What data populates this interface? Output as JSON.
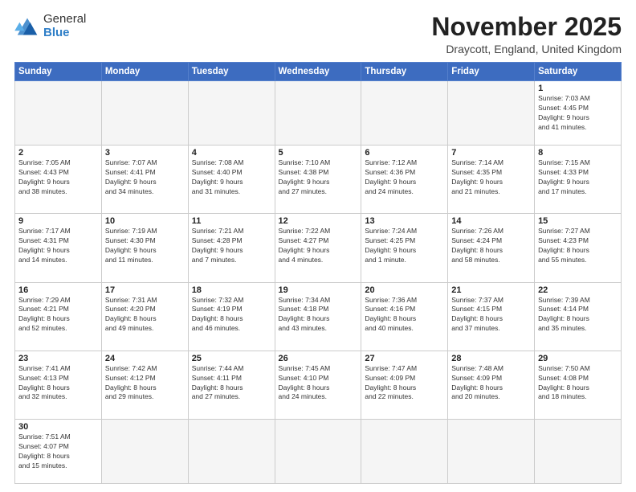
{
  "header": {
    "logo_line1": "General",
    "logo_line2": "Blue",
    "title": "November 2025",
    "subtitle": "Draycott, England, United Kingdom"
  },
  "weekdays": [
    "Sunday",
    "Monday",
    "Tuesday",
    "Wednesday",
    "Thursday",
    "Friday",
    "Saturday"
  ],
  "rows": [
    [
      {
        "day": "",
        "info": ""
      },
      {
        "day": "",
        "info": ""
      },
      {
        "day": "",
        "info": ""
      },
      {
        "day": "",
        "info": ""
      },
      {
        "day": "",
        "info": ""
      },
      {
        "day": "",
        "info": ""
      },
      {
        "day": "1",
        "info": "Sunrise: 7:03 AM\nSunset: 4:45 PM\nDaylight: 9 hours\nand 41 minutes."
      }
    ],
    [
      {
        "day": "2",
        "info": "Sunrise: 7:05 AM\nSunset: 4:43 PM\nDaylight: 9 hours\nand 38 minutes."
      },
      {
        "day": "3",
        "info": "Sunrise: 7:07 AM\nSunset: 4:41 PM\nDaylight: 9 hours\nand 34 minutes."
      },
      {
        "day": "4",
        "info": "Sunrise: 7:08 AM\nSunset: 4:40 PM\nDaylight: 9 hours\nand 31 minutes."
      },
      {
        "day": "5",
        "info": "Sunrise: 7:10 AM\nSunset: 4:38 PM\nDaylight: 9 hours\nand 27 minutes."
      },
      {
        "day": "6",
        "info": "Sunrise: 7:12 AM\nSunset: 4:36 PM\nDaylight: 9 hours\nand 24 minutes."
      },
      {
        "day": "7",
        "info": "Sunrise: 7:14 AM\nSunset: 4:35 PM\nDaylight: 9 hours\nand 21 minutes."
      },
      {
        "day": "8",
        "info": "Sunrise: 7:15 AM\nSunset: 4:33 PM\nDaylight: 9 hours\nand 17 minutes."
      }
    ],
    [
      {
        "day": "9",
        "info": "Sunrise: 7:17 AM\nSunset: 4:31 PM\nDaylight: 9 hours\nand 14 minutes."
      },
      {
        "day": "10",
        "info": "Sunrise: 7:19 AM\nSunset: 4:30 PM\nDaylight: 9 hours\nand 11 minutes."
      },
      {
        "day": "11",
        "info": "Sunrise: 7:21 AM\nSunset: 4:28 PM\nDaylight: 9 hours\nand 7 minutes."
      },
      {
        "day": "12",
        "info": "Sunrise: 7:22 AM\nSunset: 4:27 PM\nDaylight: 9 hours\nand 4 minutes."
      },
      {
        "day": "13",
        "info": "Sunrise: 7:24 AM\nSunset: 4:25 PM\nDaylight: 9 hours\nand 1 minute."
      },
      {
        "day": "14",
        "info": "Sunrise: 7:26 AM\nSunset: 4:24 PM\nDaylight: 8 hours\nand 58 minutes."
      },
      {
        "day": "15",
        "info": "Sunrise: 7:27 AM\nSunset: 4:23 PM\nDaylight: 8 hours\nand 55 minutes."
      }
    ],
    [
      {
        "day": "16",
        "info": "Sunrise: 7:29 AM\nSunset: 4:21 PM\nDaylight: 8 hours\nand 52 minutes."
      },
      {
        "day": "17",
        "info": "Sunrise: 7:31 AM\nSunset: 4:20 PM\nDaylight: 8 hours\nand 49 minutes."
      },
      {
        "day": "18",
        "info": "Sunrise: 7:32 AM\nSunset: 4:19 PM\nDaylight: 8 hours\nand 46 minutes."
      },
      {
        "day": "19",
        "info": "Sunrise: 7:34 AM\nSunset: 4:18 PM\nDaylight: 8 hours\nand 43 minutes."
      },
      {
        "day": "20",
        "info": "Sunrise: 7:36 AM\nSunset: 4:16 PM\nDaylight: 8 hours\nand 40 minutes."
      },
      {
        "day": "21",
        "info": "Sunrise: 7:37 AM\nSunset: 4:15 PM\nDaylight: 8 hours\nand 37 minutes."
      },
      {
        "day": "22",
        "info": "Sunrise: 7:39 AM\nSunset: 4:14 PM\nDaylight: 8 hours\nand 35 minutes."
      }
    ],
    [
      {
        "day": "23",
        "info": "Sunrise: 7:41 AM\nSunset: 4:13 PM\nDaylight: 8 hours\nand 32 minutes."
      },
      {
        "day": "24",
        "info": "Sunrise: 7:42 AM\nSunset: 4:12 PM\nDaylight: 8 hours\nand 29 minutes."
      },
      {
        "day": "25",
        "info": "Sunrise: 7:44 AM\nSunset: 4:11 PM\nDaylight: 8 hours\nand 27 minutes."
      },
      {
        "day": "26",
        "info": "Sunrise: 7:45 AM\nSunset: 4:10 PM\nDaylight: 8 hours\nand 24 minutes."
      },
      {
        "day": "27",
        "info": "Sunrise: 7:47 AM\nSunset: 4:09 PM\nDaylight: 8 hours\nand 22 minutes."
      },
      {
        "day": "28",
        "info": "Sunrise: 7:48 AM\nSunset: 4:09 PM\nDaylight: 8 hours\nand 20 minutes."
      },
      {
        "day": "29",
        "info": "Sunrise: 7:50 AM\nSunset: 4:08 PM\nDaylight: 8 hours\nand 18 minutes."
      }
    ],
    [
      {
        "day": "30",
        "info": "Sunrise: 7:51 AM\nSunset: 4:07 PM\nDaylight: 8 hours\nand 15 minutes."
      },
      {
        "day": "",
        "info": ""
      },
      {
        "day": "",
        "info": ""
      },
      {
        "day": "",
        "info": ""
      },
      {
        "day": "",
        "info": ""
      },
      {
        "day": "",
        "info": ""
      },
      {
        "day": "",
        "info": ""
      }
    ]
  ]
}
